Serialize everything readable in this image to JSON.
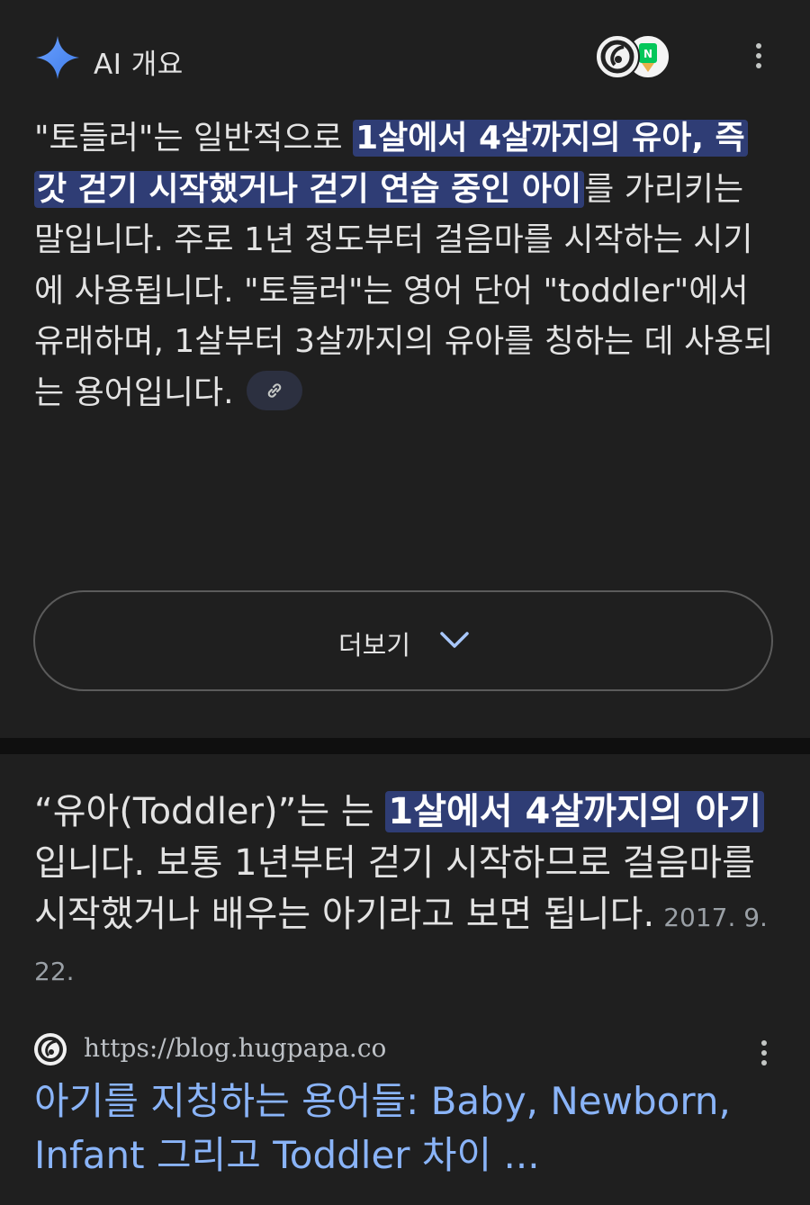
{
  "ai_overview": {
    "title": "AI 개요",
    "paragraph": {
      "before": "\"토들러\"는 일반적으로 ",
      "highlight": "1살에서 4살까지의 유아, 즉 갓 걷기 시작했거나 걷기 연습 중인 아이",
      "after": "를 가리키는 말입니다. 주로 1년 정도부터 걸음마를 시작하는 시기에 사용됩니다. \"토들러\"는 영어 단어 \"toddler\"에서 유래하며, 1살부터 3살까지의 유아를 칭하는 데 사용되는 용어입니다."
    },
    "more_button_label": "더보기",
    "colors": {
      "accent_star": "#4c8df6",
      "highlight_bg": "#2f3d75"
    }
  },
  "featured_snippet": {
    "before": "“유아(Toddler)”는 는 ",
    "highlight": "1살에서 4살까지의 아기",
    "after": "입니다. 보통 1년부터 걷기 시작하므로 걸음마를 시작했거나 배우는 아기라고 보면 됩니다.",
    "date": "2017. 9. 22."
  },
  "source": {
    "url": "https://blog.hugpapa.co",
    "title": "아기를 지칭하는 용어들: Baby, Newborn, Infant 그리고 Toddler 차이 ...",
    "link_color": "#8ab4f8"
  }
}
